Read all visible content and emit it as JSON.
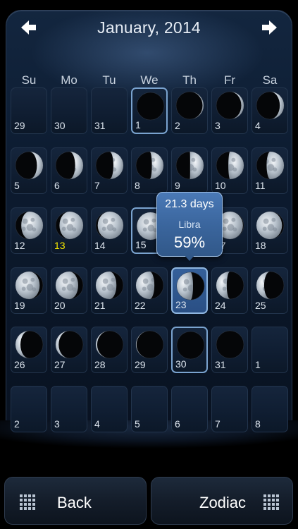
{
  "header": {
    "title": "January, 2014",
    "prev_icon": "arrow-left-icon",
    "next_icon": "arrow-right-icon"
  },
  "weekdays": [
    "Su",
    "Mo",
    "Tu",
    "We",
    "Th",
    "Fr",
    "Sa"
  ],
  "calendar": {
    "today": "13",
    "selected": "23",
    "weeks": [
      [
        {
          "d": "29",
          "p": -1
        },
        {
          "d": "30",
          "p": -1
        },
        {
          "d": "31",
          "p": -1
        },
        {
          "d": "1",
          "p": 0.0,
          "box": true
        },
        {
          "d": "2",
          "p": 0.04
        },
        {
          "d": "3",
          "p": 0.09
        },
        {
          "d": "4",
          "p": 0.15
        }
      ],
      [
        {
          "d": "5",
          "p": 0.22
        },
        {
          "d": "6",
          "p": 0.29
        },
        {
          "d": "7",
          "p": 0.36
        },
        {
          "d": "8",
          "p": 0.42
        },
        {
          "d": "9",
          "p": 0.49
        },
        {
          "d": "10",
          "p": 0.56
        },
        {
          "d": "11",
          "p": 0.63
        }
      ],
      [
        {
          "d": "12",
          "p": 0.79
        },
        {
          "d": "13",
          "p": 0.86
        },
        {
          "d": "14",
          "p": 0.93
        },
        {
          "d": "15",
          "p": 0.99,
          "box": true
        },
        {
          "d": "16",
          "p": 1.0
        },
        {
          "d": "17",
          "p": 0.97
        },
        {
          "d": "18",
          "p": 0.93
        }
      ],
      [
        {
          "d": "19",
          "p": 0.88
        },
        {
          "d": "20",
          "p": 0.82
        },
        {
          "d": "21",
          "p": 0.75
        },
        {
          "d": "22",
          "p": 0.67
        },
        {
          "d": "23",
          "p": 0.59,
          "box": true
        },
        {
          "d": "24",
          "p": 0.38
        },
        {
          "d": "25",
          "p": 0.28
        }
      ],
      [
        {
          "d": "26",
          "p": 0.18
        },
        {
          "d": "27",
          "p": 0.11
        },
        {
          "d": "28",
          "p": 0.05
        },
        {
          "d": "29",
          "p": 0.02
        },
        {
          "d": "30",
          "p": 0.0,
          "box": true
        },
        {
          "d": "31",
          "p": 0.0
        },
        {
          "d": "1",
          "p": -1
        }
      ],
      [
        {
          "d": "2",
          "p": -1
        },
        {
          "d": "3",
          "p": -1
        },
        {
          "d": "4",
          "p": -1
        },
        {
          "d": "5",
          "p": -1
        },
        {
          "d": "6",
          "p": -1
        },
        {
          "d": "7",
          "p": -1
        },
        {
          "d": "8",
          "p": -1
        }
      ]
    ]
  },
  "popup": {
    "days": "21.3 days",
    "sign": "Libra",
    "percent": "59%"
  },
  "buttons": {
    "back_label": "Back",
    "zodiac_label": "Zodiac",
    "grid_icon": "grid-dots-icon"
  },
  "colors": {
    "today": "#f5e700",
    "accent": "#4a79b6"
  }
}
